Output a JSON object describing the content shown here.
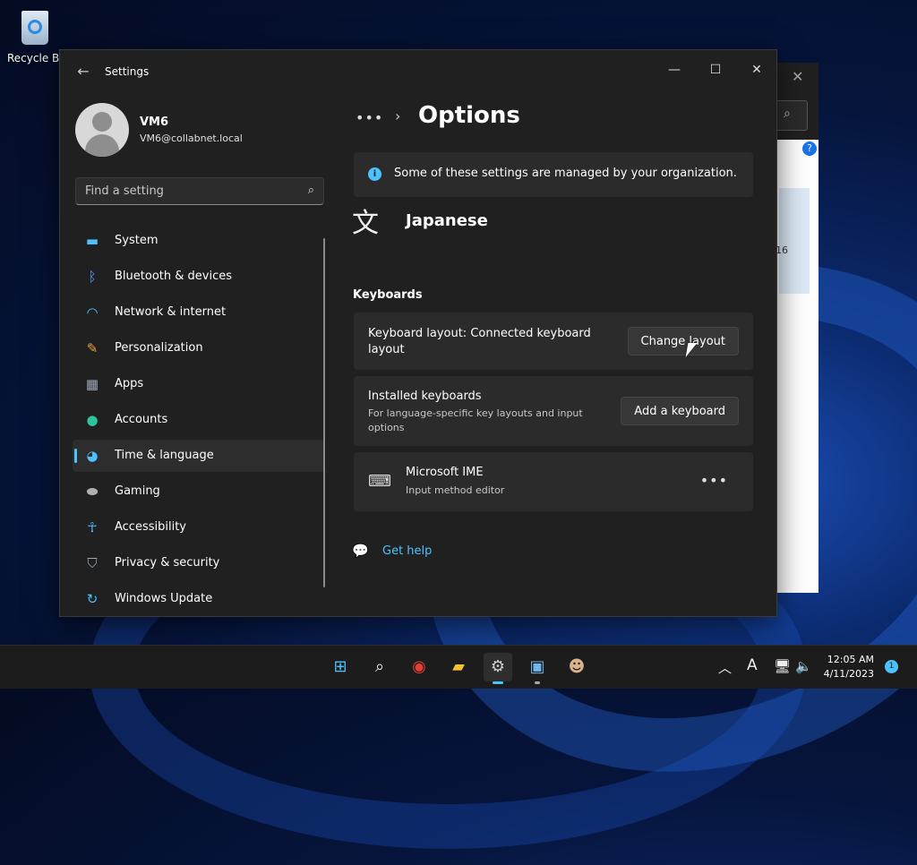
{
  "desktop": {
    "recycle_bin_label": "Recycle Bin"
  },
  "background_window": {
    "partial_text": "16"
  },
  "window": {
    "title": "Settings",
    "user": {
      "name": "VM6",
      "email": "VM6@collabnet.local"
    },
    "search": {
      "placeholder": "Find a setting"
    },
    "nav": [
      {
        "label": "System",
        "icon": "system-icon",
        "color": "#4cc2ff"
      },
      {
        "label": "Bluetooth & devices",
        "icon": "bluetooth-icon",
        "color": "#0078d4"
      },
      {
        "label": "Network & internet",
        "icon": "wifi-icon",
        "color": "#4cc2ff"
      },
      {
        "label": "Personalization",
        "icon": "brush-icon",
        "color": "#e8a33c"
      },
      {
        "label": "Apps",
        "icon": "apps-icon",
        "color": "#9aa7b5"
      },
      {
        "label": "Accounts",
        "icon": "accounts-icon",
        "color": "#2fc59b"
      },
      {
        "label": "Time & language",
        "icon": "globe-clock-icon",
        "color": "#4cc2ff",
        "active": true
      },
      {
        "label": "Gaming",
        "icon": "gamepad-icon",
        "color": "#b0b0b0"
      },
      {
        "label": "Accessibility",
        "icon": "accessibility-icon",
        "color": "#4cc2ff"
      },
      {
        "label": "Privacy & security",
        "icon": "shield-icon",
        "color": "#9aa7b5"
      },
      {
        "label": "Windows Update",
        "icon": "update-icon",
        "color": "#4cc2ff"
      }
    ],
    "breadcrumb": {
      "ellipsis": "•••",
      "title": "Options"
    },
    "banner": "Some of these settings are managed by your organization.",
    "language": {
      "name": "Japanese"
    },
    "keyboards_heading": "Keyboards",
    "layout_card": {
      "label": "Keyboard layout: Connected keyboard layout",
      "button": "Change layout"
    },
    "installed_card": {
      "label": "Installed keyboards",
      "desc": "For language-specific key layouts and input options",
      "button": "Add a keyboard"
    },
    "ime_card": {
      "name": "Microsoft IME",
      "desc": "Input method editor",
      "more": "•••"
    },
    "get_help": "Get help"
  },
  "taskbar": {
    "clock_time": "12:05 AM",
    "clock_date": "4/11/2023",
    "notification_count": "1",
    "input_indicator": "A",
    "accent": "#4cc2ff"
  }
}
